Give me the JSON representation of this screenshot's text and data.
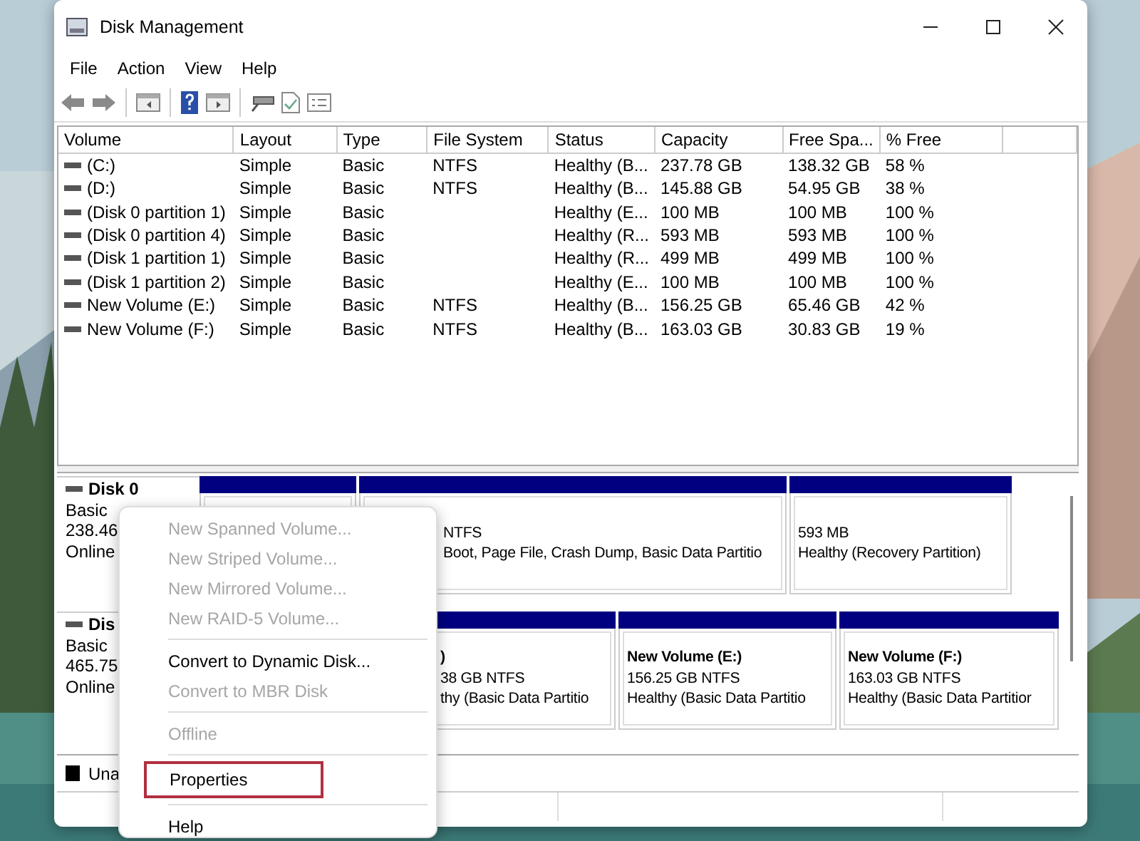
{
  "window": {
    "title": "Disk Management"
  },
  "menu": [
    "File",
    "Action",
    "View",
    "Help"
  ],
  "volumes": {
    "columns": [
      "Volume",
      "Layout",
      "Type",
      "File System",
      "Status",
      "Capacity",
      "Free Spa...",
      "% Free"
    ],
    "rows": [
      [
        "(C:)",
        "Simple",
        "Basic",
        "NTFS",
        "Healthy (B...",
        "237.78 GB",
        "138.32 GB",
        "58 %"
      ],
      [
        "(D:)",
        "Simple",
        "Basic",
        "NTFS",
        "Healthy (B...",
        "145.88 GB",
        "54.95 GB",
        "38 %"
      ],
      [
        "(Disk 0 partition 1)",
        "Simple",
        "Basic",
        "",
        "Healthy (E...",
        "100 MB",
        "100 MB",
        "100 %"
      ],
      [
        "(Disk 0 partition 4)",
        "Simple",
        "Basic",
        "",
        "Healthy (R...",
        "593 MB",
        "593 MB",
        "100 %"
      ],
      [
        "(Disk 1 partition 1)",
        "Simple",
        "Basic",
        "",
        "Healthy (R...",
        "499 MB",
        "499 MB",
        "100 %"
      ],
      [
        "(Disk 1 partition 2)",
        "Simple",
        "Basic",
        "",
        "Healthy (E...",
        "100 MB",
        "100 MB",
        "100 %"
      ],
      [
        "New Volume (E:)",
        "Simple",
        "Basic",
        "NTFS",
        "Healthy (B...",
        "156.25 GB",
        "65.46 GB",
        "42 %"
      ],
      [
        "New Volume (F:)",
        "Simple",
        "Basic",
        "NTFS",
        "Healthy (B...",
        "163.03 GB",
        "30.83 GB",
        "19 %"
      ]
    ]
  },
  "disks": [
    {
      "name": "Disk 0",
      "details": [
        "Basic",
        "238.46",
        "Online"
      ],
      "partitions": [
        {
          "kind": "covered"
        },
        {
          "kind": "partition",
          "lines": [
            "NTFS",
            "Boot, Page File, Crash Dump, Basic Data Partitio"
          ]
        },
        {
          "kind": "partition",
          "lines": [
            "593 MB",
            "Healthy (Recovery Partition)"
          ]
        }
      ]
    },
    {
      "name": "Dis",
      "details": [
        "Basic",
        "465.75",
        "Online"
      ],
      "partitions": [
        {
          "kind": "partition",
          "name": ")",
          "lines": [
            "38 GB NTFS",
            "thy (Basic Data Partitio"
          ]
        },
        {
          "kind": "partition",
          "name": "New Volume  (E:)",
          "lines": [
            "156.25 GB NTFS",
            "Healthy (Basic Data Partitio"
          ]
        },
        {
          "kind": "partition",
          "name": "New Volume  (F:)",
          "lines": [
            "163.03 GB NTFS",
            "Healthy (Basic Data Partitior"
          ]
        }
      ]
    }
  ],
  "legend": [
    "Una"
  ],
  "context_menu": [
    {
      "kind": "item",
      "label": "New Spanned Volume...",
      "disabled": true,
      "highlighted": false
    },
    {
      "kind": "item",
      "label": "New Striped Volume...",
      "disabled": true,
      "highlighted": false
    },
    {
      "kind": "item",
      "label": "New Mirrored Volume...",
      "disabled": true,
      "highlighted": false
    },
    {
      "kind": "item",
      "label": "New RAID-5 Volume...",
      "disabled": true,
      "highlighted": false
    },
    {
      "kind": "separator"
    },
    {
      "kind": "item",
      "label": "Convert to Dynamic Disk...",
      "disabled": false,
      "highlighted": false
    },
    {
      "kind": "item",
      "label": "Convert to MBR Disk",
      "disabled": true,
      "highlighted": false
    },
    {
      "kind": "separator"
    },
    {
      "kind": "item",
      "label": "Offline",
      "disabled": true,
      "highlighted": false
    },
    {
      "kind": "separator"
    },
    {
      "kind": "item",
      "label": "Properties",
      "disabled": false,
      "highlighted": true
    },
    {
      "kind": "separator"
    },
    {
      "kind": "item",
      "label": "Help",
      "disabled": false,
      "highlighted": false
    }
  ]
}
